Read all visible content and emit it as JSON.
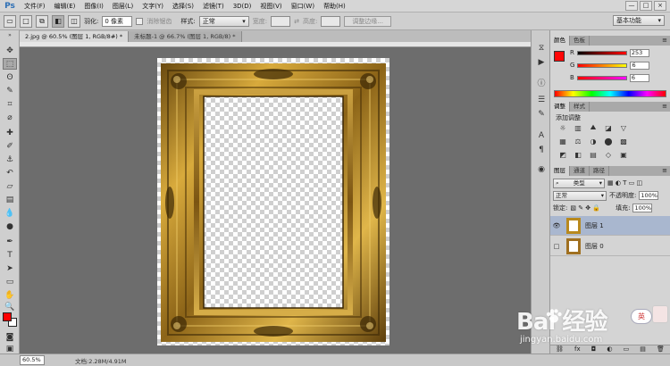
{
  "app": {
    "logo": "Ps",
    "menu": [
      "文件(F)",
      "编辑(E)",
      "图像(I)",
      "图层(L)",
      "文字(Y)",
      "选择(S)",
      "滤镜(T)",
      "3D(D)",
      "视图(V)",
      "窗口(W)",
      "帮助(H)"
    ],
    "window_controls": [
      "—",
      "□",
      "×"
    ]
  },
  "options_bar": {
    "feather_label": "羽化:",
    "feather_value": "0 像素",
    "antialias_label": "消除锯齿",
    "style_label": "样式:",
    "style_value": "正常",
    "width_label": "宽度:",
    "height_label": "高度:",
    "refine_edge": "调整边缘...",
    "workspace": "基本功能"
  },
  "documents": {
    "tabs": [
      "2.jpg @ 60.5% (图层 1, RGB/8#) *",
      "未标题-1 @ 66.7% (图层 1, RGB/8) *"
    ],
    "active_tab": 0
  },
  "status": {
    "zoom": "60.5%",
    "doc_info": "文档:2.28M/4.91M"
  },
  "color_panel": {
    "tabs": [
      "颜色",
      "色板"
    ],
    "r_label": "R",
    "r_value": "253",
    "g_label": "G",
    "g_value": "6",
    "b_label": "B",
    "b_value": "6",
    "foreground": "#ff0606"
  },
  "adjust_panel": {
    "tabs": [
      "调整",
      "样式"
    ],
    "title": "添加调整",
    "row1": [
      "☼",
      "▥",
      "⛰",
      "◪",
      "▽"
    ],
    "row2": [
      "▦",
      "⚖",
      "◑",
      "⬤",
      "▩"
    ],
    "row3": [
      "◩",
      "◧",
      "▤",
      "◇",
      "▣"
    ]
  },
  "layers_panel": {
    "tabs": [
      "图层",
      "通道",
      "路径"
    ],
    "filter_label": "类型",
    "blend_mode": "正常",
    "opacity_label": "不透明度:",
    "opacity_value": "100%",
    "lock_label": "锁定:",
    "fill_label": "填充:",
    "fill_value": "100%",
    "layers": [
      {
        "name": "图层 1",
        "visible": true,
        "selected": true
      },
      {
        "name": "图层 0",
        "visible": false,
        "selected": false
      }
    ],
    "footer_icons": [
      "⛓",
      "fx",
      "◘",
      "◐",
      "▭",
      "▤",
      "🗑"
    ]
  },
  "watermark": {
    "logo": "Bai  经验",
    "url": "jingyan.baidu.com",
    "ime": "英"
  },
  "colors": {
    "foreground_swatch": "#ff0000",
    "background_swatch": "#ffffff",
    "frame_gold": "#b8891e"
  }
}
